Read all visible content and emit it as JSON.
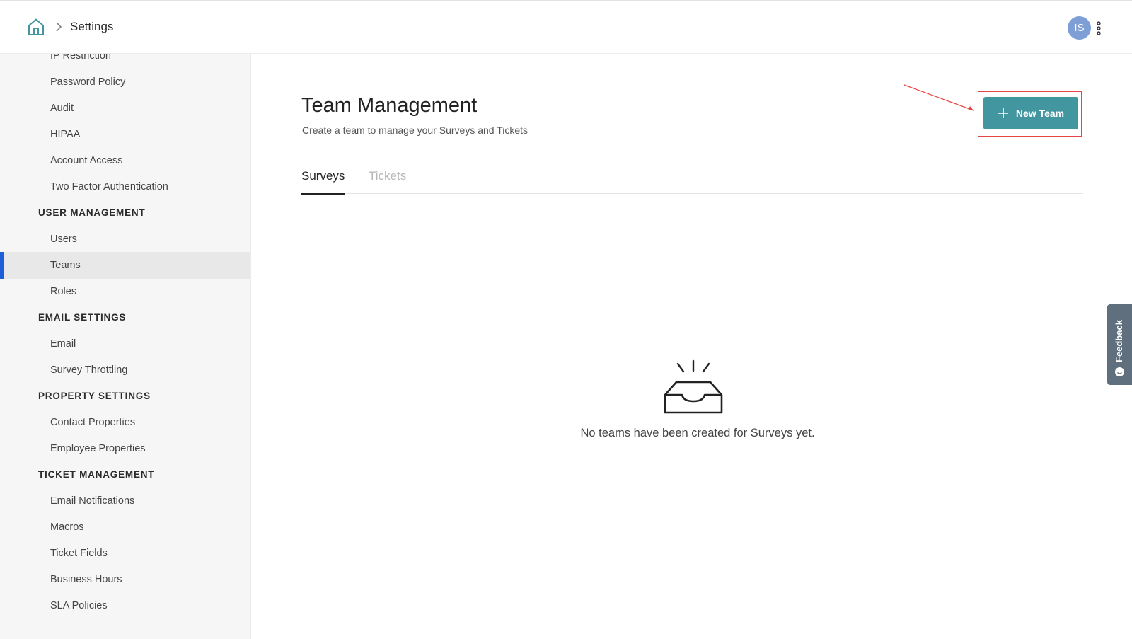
{
  "header": {
    "breadcrumb_title": "Settings",
    "avatar_initials": "IS",
    "home_icon": "home-icon",
    "menu_icon": "kebab-menu-icon"
  },
  "sidebar": {
    "items": [
      {
        "type": "item",
        "label": "IP Restriction"
      },
      {
        "type": "item",
        "label": "Password Policy"
      },
      {
        "type": "item",
        "label": "Audit"
      },
      {
        "type": "item",
        "label": "HIPAA"
      },
      {
        "type": "item",
        "label": "Account Access"
      },
      {
        "type": "item",
        "label": "Two Factor Authentication"
      },
      {
        "type": "heading",
        "label": "USER MANAGEMENT"
      },
      {
        "type": "item",
        "label": "Users"
      },
      {
        "type": "item",
        "label": "Teams",
        "active": true
      },
      {
        "type": "item",
        "label": "Roles"
      },
      {
        "type": "heading",
        "label": "EMAIL SETTINGS"
      },
      {
        "type": "item",
        "label": "Email"
      },
      {
        "type": "item",
        "label": "Survey Throttling"
      },
      {
        "type": "heading",
        "label": "PROPERTY SETTINGS"
      },
      {
        "type": "item",
        "label": "Contact Properties"
      },
      {
        "type": "item",
        "label": "Employee Properties"
      },
      {
        "type": "heading",
        "label": "TICKET MANAGEMENT"
      },
      {
        "type": "item",
        "label": "Email Notifications"
      },
      {
        "type": "item",
        "label": "Macros"
      },
      {
        "type": "item",
        "label": "Ticket Fields"
      },
      {
        "type": "item",
        "label": "Business Hours"
      },
      {
        "type": "item",
        "label": "SLA Policies"
      }
    ]
  },
  "main": {
    "title": "Team Management",
    "subtitle": "Create a team to manage your Surveys and Tickets",
    "new_team_label": "New Team",
    "tabs": [
      {
        "label": "Surveys",
        "active": true
      },
      {
        "label": "Tickets",
        "active": false
      }
    ],
    "empty_message": "No teams have been created for Surveys yet."
  },
  "feedback": {
    "label": "Feedback"
  },
  "colors": {
    "accent": "#4296a0",
    "active_indicator": "#1d5ed8",
    "annotation": "#e64545",
    "avatar": "#7d9fd6"
  }
}
